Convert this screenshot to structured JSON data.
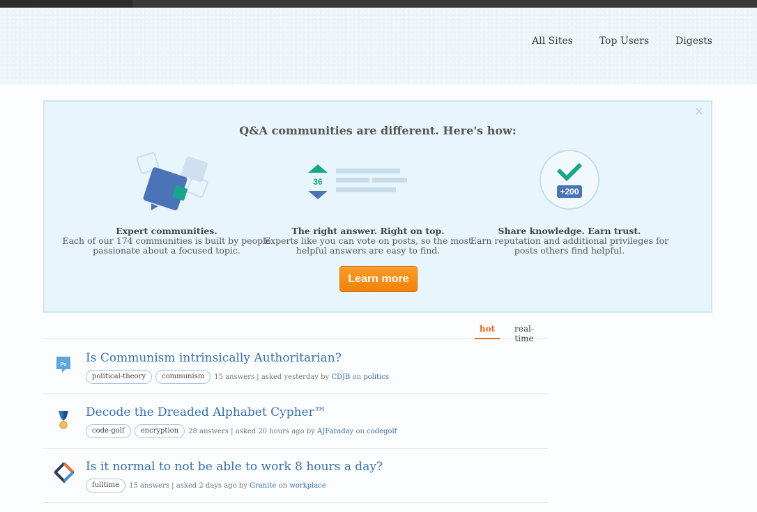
{
  "nav": [
    "All Sites",
    "Top Users",
    "Digests"
  ],
  "promo": {
    "close": "×",
    "title": "Q&A communities are different. Here's how:",
    "features": [
      {
        "title": "Expert communities.",
        "desc1": "Each of our 174 communities is built by people",
        "desc2": "passionate about a focused topic."
      },
      {
        "title": "The right answer. Right on top.",
        "desc1": "Experts like you can vote on posts, so the most",
        "desc2": "helpful answers are easy to find."
      },
      {
        "title": "Share knowledge. Earn trust.",
        "desc1": "Earn reputation and additional privileges for",
        "desc2": "posts others find helpful."
      }
    ],
    "vote_count": "36",
    "rep_badge": "+200",
    "learn_more": "Learn more"
  },
  "tabs": [
    "hot",
    "real-time"
  ],
  "questions": [
    {
      "title": "Is Communism intrinsically Authoritarian?",
      "tags": [
        "political-theory",
        "communism"
      ],
      "answers": "15 answers",
      "asked": "asked yesterday by",
      "user": "CDJB",
      "on": "on",
      "site": "politics",
      "icon": "politics-site-icon",
      "icon_label": "Po"
    },
    {
      "title": "Decode the Dreaded Alphabet Cypher™",
      "tags": [
        "code-golf",
        "encryption"
      ],
      "answers": "28 answers",
      "asked": "asked 20 hours ago by",
      "user": "AJFaraday",
      "on": "on",
      "site": "codegolf",
      "icon": "codegolf-site-icon"
    },
    {
      "title": "Is it normal to not be able to work 8 hours a day?",
      "tags": [
        "fulltime"
      ],
      "answers": "15 answers",
      "asked": "asked 2 days ago by",
      "user": "Granite",
      "on": "on",
      "site": "workplace",
      "icon": "workplace-site-icon"
    }
  ]
}
